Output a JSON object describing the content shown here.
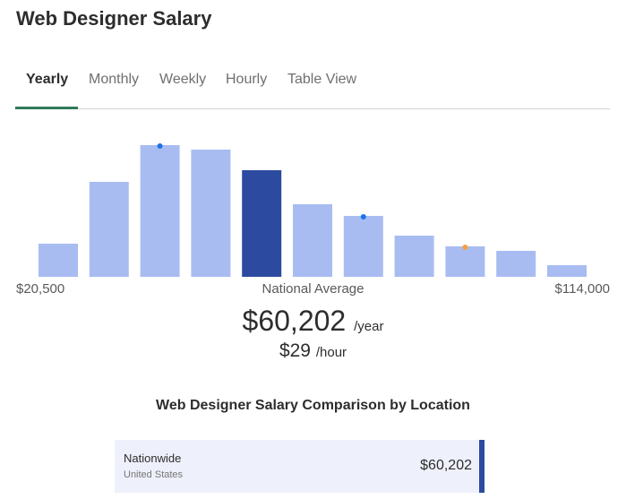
{
  "title": "Web Designer Salary",
  "tabs": [
    {
      "label": "Yearly",
      "active": true
    },
    {
      "label": "Monthly"
    },
    {
      "label": "Weekly"
    },
    {
      "label": "Hourly"
    },
    {
      "label": "Table View"
    }
  ],
  "chart_data": {
    "type": "bar",
    "values": [
      37,
      106,
      147,
      142,
      119,
      81,
      68,
      46,
      34,
      29,
      13
    ],
    "highlight_index": 4,
    "markers": [
      {
        "index": 2,
        "color": "#1a73e8"
      },
      {
        "index": 6,
        "color": "#1a73e8"
      },
      {
        "index": 8,
        "color": "#f5a142"
      }
    ],
    "bar_color": "#a9bcf2",
    "highlight_color": "#2c4ba0",
    "min_label": "$20,500",
    "center_label": "National Average",
    "max_label": "$114,000"
  },
  "average": {
    "yearly": "$60,202",
    "yearly_unit": "/year",
    "hourly": "$29",
    "hourly_unit": "/hour"
  },
  "comparison": {
    "title": "Web Designer Salary Comparison by Location",
    "location": "Nationwide",
    "sublocation": "United States",
    "value": "$60,202"
  }
}
